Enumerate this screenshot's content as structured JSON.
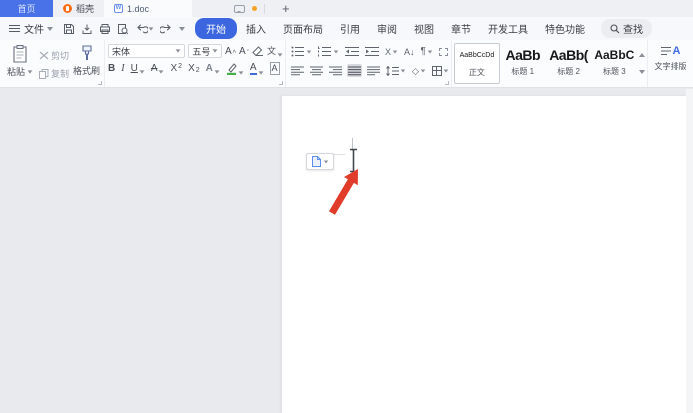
{
  "window": {
    "tabs": [
      {
        "label": "首页"
      },
      {
        "label": "稻壳"
      },
      {
        "label": "1.doc"
      }
    ],
    "new_tab": "+"
  },
  "menu": {
    "file": "文件",
    "ribbon_tabs": [
      {
        "label": "开始",
        "active": true
      },
      {
        "label": "插入"
      },
      {
        "label": "页面布局"
      },
      {
        "label": "引用"
      },
      {
        "label": "审阅"
      },
      {
        "label": "视图"
      },
      {
        "label": "章节"
      },
      {
        "label": "开发工具"
      },
      {
        "label": "特色功能"
      }
    ],
    "find": "查找"
  },
  "ribbon": {
    "clipboard": {
      "paste": "粘贴",
      "cut": "剪切",
      "copy": "复制",
      "format_painter": "格式刷"
    },
    "font": {
      "family": "宋体",
      "size": "五号",
      "bold": "B",
      "italic": "I",
      "underline": "U",
      "strike": "A",
      "superscript_base": "X",
      "superscript_mark": "2",
      "subscript_base": "X",
      "subscript_mark": "2",
      "effects": "A",
      "color": "A",
      "shading_char": "A",
      "phonetic": "文",
      "grow": "A",
      "shrink": "A"
    },
    "paragraph": {
      "asian_layout": "X",
      "sort": "A↓",
      "pilcrow": "¶",
      "shading": "◇"
    },
    "styles": [
      {
        "preview": "AaBbCcDd",
        "label": "正文",
        "selected": true
      },
      {
        "preview": "AaBb",
        "label": "标题 1"
      },
      {
        "preview": "AaBb(",
        "label": "标题 2"
      },
      {
        "preview": "AaBbC",
        "label": "标题 3"
      }
    ],
    "text_layout": "文字排版"
  },
  "colors": {
    "accent_blue": "#3b66e0",
    "home_tab_blue": "#4a72e8",
    "docer_orange": "#ff6e17",
    "notification_orange": "#f7a325",
    "arrow_red": "#e13b2a",
    "workspace_gray": "#e9eaee"
  },
  "icons": [
    "flame-icon",
    "doc-icon",
    "chat-icon",
    "plus-icon",
    "hamburger-icon",
    "save-icon",
    "export-icon",
    "print-icon",
    "preview-icon",
    "undo-icon",
    "redo-icon",
    "search-icon",
    "paste-icon",
    "cut-icon",
    "copy-icon",
    "format-painter-icon",
    "eraser-icon",
    "highlight-pen-icon",
    "i-beam-cursor",
    "red-arrow-annotation",
    "paste-options-icon"
  ]
}
